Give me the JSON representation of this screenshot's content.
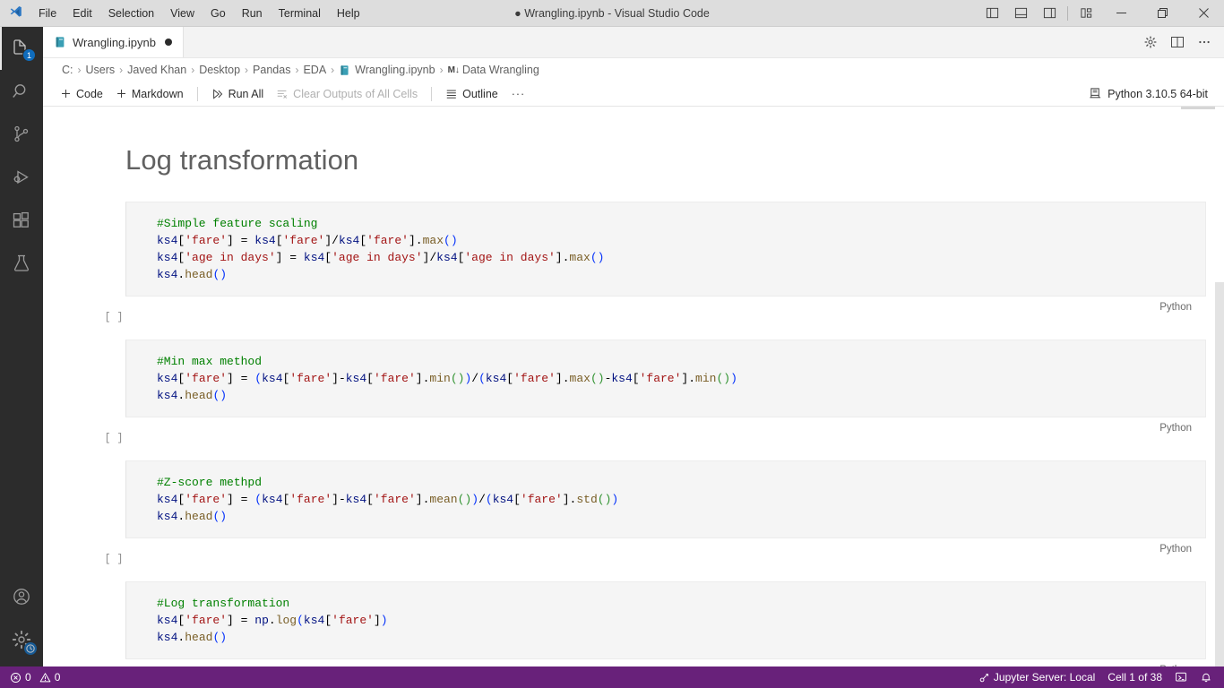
{
  "window": {
    "title": "Wrangling.ipynb - Visual Studio Code",
    "dirty_marker": "●",
    "menus": [
      "File",
      "Edit",
      "Selection",
      "View",
      "Go",
      "Run",
      "Terminal",
      "Help"
    ],
    "controls": {
      "toggle_primary_sidebar": "toggle-primary-sidebar-icon",
      "toggle_panel": "toggle-panel-icon",
      "toggle_secondary_sidebar": "toggle-secondary-sidebar-icon",
      "customize_layout": "customize-layout-icon",
      "minimize": "minimize-icon",
      "maximize": "maximize-icon",
      "close": "close-icon"
    }
  },
  "activitybar": {
    "items": [
      {
        "name": "explorer",
        "icon": "files-icon",
        "badge": "1",
        "active": true
      },
      {
        "name": "search",
        "icon": "search-icon",
        "badge": "",
        "active": false
      },
      {
        "name": "source-control",
        "icon": "source-control-icon",
        "badge": "",
        "active": false
      },
      {
        "name": "run-and-debug",
        "icon": "run-debug-icon",
        "badge": "",
        "active": false
      },
      {
        "name": "extensions",
        "icon": "extensions-icon",
        "badge": "",
        "active": false
      },
      {
        "name": "testing",
        "icon": "beaker-icon",
        "badge": "",
        "active": false
      }
    ],
    "bottom": [
      {
        "name": "accounts",
        "icon": "account-icon"
      },
      {
        "name": "manage",
        "icon": "gear-icon",
        "badge_icon": "clock-badge-icon"
      }
    ]
  },
  "tabs": {
    "items": [
      {
        "label": "Wrangling.ipynb",
        "icon": "notebook-icon",
        "dirty": "●",
        "active": true
      }
    ],
    "actions": [
      {
        "name": "notebook-settings",
        "icon": "gear-icon"
      },
      {
        "name": "split-editor",
        "icon": "split-editor-icon"
      },
      {
        "name": "more-actions",
        "icon": "ellipsis-icon"
      }
    ]
  },
  "breadcrumbs": {
    "separator": "›",
    "items": [
      {
        "label": "C:",
        "icon": ""
      },
      {
        "label": "Users",
        "icon": ""
      },
      {
        "label": "Javed Khan",
        "icon": ""
      },
      {
        "label": "Desktop",
        "icon": ""
      },
      {
        "label": "Pandas",
        "icon": ""
      },
      {
        "label": "EDA",
        "icon": ""
      },
      {
        "label": "Wrangling.ipynb",
        "icon": "notebook-icon"
      },
      {
        "label": "Data Wrangling",
        "icon": "markdown-icon"
      }
    ]
  },
  "notebook_toolbar": {
    "add_code": "Code",
    "add_markdown": "Markdown",
    "run_all": "Run All",
    "clear_outputs": "Clear Outputs of All Cells",
    "outline": "Outline",
    "more": "···",
    "kernel": "Python 3.10.5 64-bit"
  },
  "notebook": {
    "heading": "Log transformation",
    "language_label": "Python",
    "exec_placeholder": "[ ]",
    "cells": [
      {
        "id": "cell-simple-feature-scaling",
        "exec": "[ ]",
        "language": "Python",
        "lines": [
          "#Simple feature scaling",
          "ks4['fare'] = ks4['fare']/ks4['fare'].max()",
          "ks4['age in days'] = ks4['age in days']/ks4['age in days'].max()",
          "ks4.head()"
        ]
      },
      {
        "id": "cell-min-max-method",
        "exec": "[ ]",
        "language": "Python",
        "lines": [
          "#Min max method",
          "ks4['fare'] = (ks4['fare']-ks4['fare'].min())/(ks4['fare'].max()-ks4['fare'].min())",
          "ks4.head()"
        ]
      },
      {
        "id": "cell-z-score-method",
        "exec": "[ ]",
        "language": "Python",
        "lines": [
          "#Z-score methpd",
          "ks4['fare'] = (ks4['fare']-ks4['fare'].mean())/(ks4['fare'].std())",
          "ks4.head()"
        ]
      },
      {
        "id": "cell-log-transformation",
        "exec": "[ ]",
        "language": "Python",
        "lines": [
          "#Log transformation",
          "ks4['fare'] = np.log(ks4['fare'])",
          "ks4.head()"
        ]
      }
    ]
  },
  "statusbar": {
    "errors": "0",
    "warnings": "0",
    "jupyter_server": "Jupyter Server: Local",
    "cell_position": "Cell 1 of 38",
    "interactive_icon": "open-interactive-window-icon",
    "bell_icon": "bell-icon",
    "background": "#68217a"
  },
  "theme": {
    "accent": "#0f6cbd",
    "activitybar_bg": "#2c2c2c",
    "titlebar_bg": "#dddddd",
    "cell_bg": "#f5f5f5",
    "comment": "#008000",
    "string": "#a31515",
    "variable": "#001080",
    "function": "#795e26"
  }
}
